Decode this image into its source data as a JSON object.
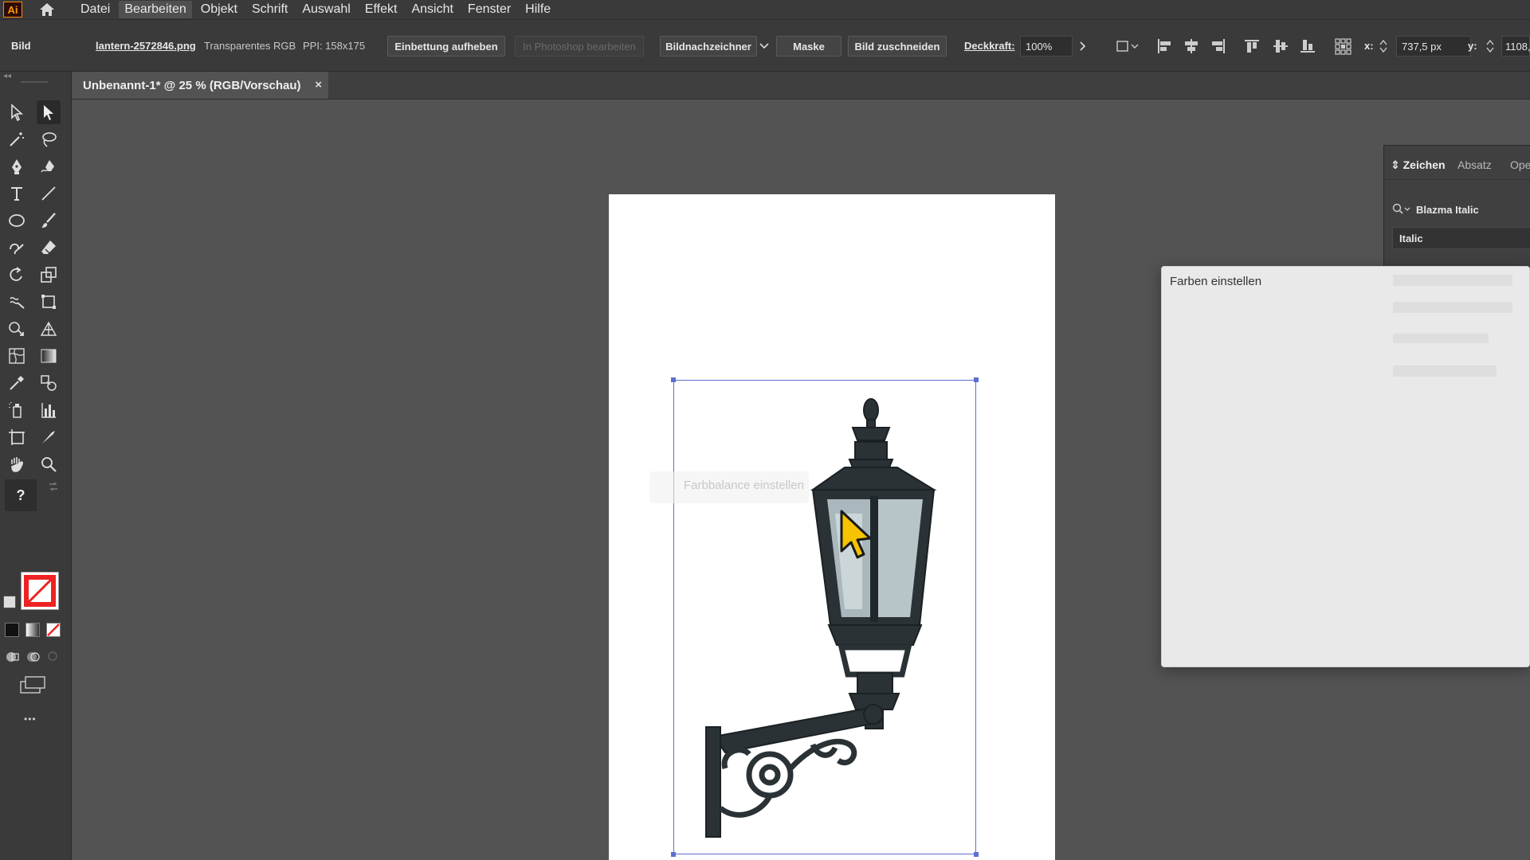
{
  "app": {
    "logo_text": "Ai"
  },
  "menu": [
    "Datei",
    "Bearbeiten",
    "Objekt",
    "Schrift",
    "Auswahl",
    "Effekt",
    "Ansicht",
    "Fenster",
    "Hilfe"
  ],
  "menu_active_index": 1,
  "control_bar": {
    "object_type": "Bild",
    "filename": "lantern-2572846.png",
    "color_mode": "Transparentes RGB",
    "ppi": "PPI: 158x175",
    "unembed_button": "Einbettung aufheben",
    "photoshop_button": "In Photoshop bearbeiten",
    "trace_button": "Bildnachzeichner",
    "mask_button": "Maske",
    "crop_button": "Bild zuschneiden",
    "opacity_label": "Deckkraft:",
    "opacity_value": "100%",
    "x_label": "x:",
    "x_value": "737,5 px",
    "y_label": "y:",
    "y_value": "1108,"
  },
  "document_tab": {
    "title": "Unbenannt-1* @ 25 % (RGB/Vorschau)",
    "close": "×"
  },
  "toolbar": {
    "question_mark": "?",
    "more": "•••"
  },
  "character_panel": {
    "tabs": [
      "Zeichen",
      "Absatz",
      "Ope"
    ],
    "font_family": "Blazma Italic",
    "font_style": "Italic"
  },
  "dialog": {
    "title": "Farben einstellen"
  },
  "ghost_label": "Farbbalance einstellen",
  "colors": {
    "ui_dark": "#3a3a3a",
    "canvas_bg": "#535353",
    "selection": "#5b6fd1",
    "accent_orange": "#ff9a00"
  }
}
